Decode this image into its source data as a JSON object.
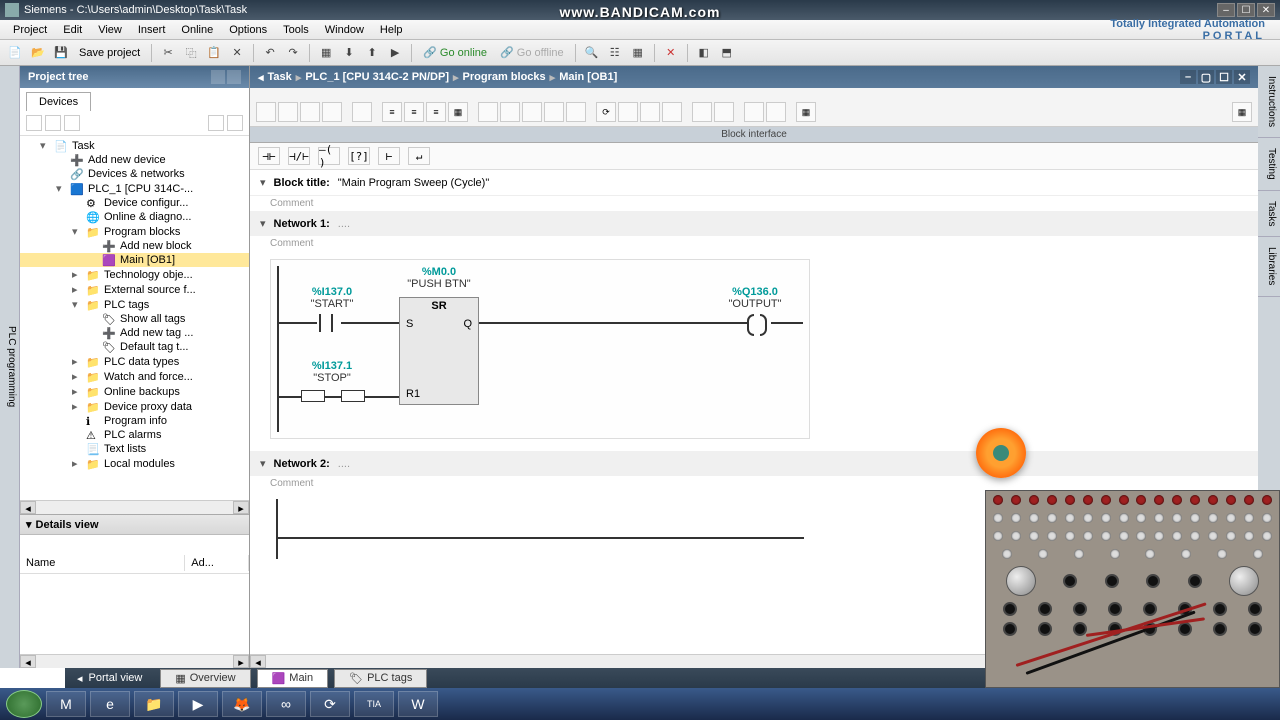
{
  "window": {
    "title": "Siemens  -  C:\\Users\\admin\\Desktop\\Task\\Task"
  },
  "watermark": "www.BANDICAM.com",
  "menus": [
    "Project",
    "Edit",
    "View",
    "Insert",
    "Online",
    "Options",
    "Tools",
    "Window",
    "Help"
  ],
  "brand": {
    "line1": "Totally Integrated Automation",
    "line2": "PORTAL"
  },
  "toolbar": {
    "save": "Save project",
    "go_online": "Go online",
    "go_offline": "Go offline"
  },
  "project_tree": {
    "title": "Project tree",
    "devices_tab": "Devices",
    "vtab_label": "PLC programming",
    "items": [
      {
        "ind": 1,
        "exp": "▾",
        "icon": "📄",
        "label": "Task"
      },
      {
        "ind": 2,
        "exp": "",
        "icon": "➕",
        "label": "Add new device"
      },
      {
        "ind": 2,
        "exp": "",
        "icon": "🔗",
        "label": "Devices & networks"
      },
      {
        "ind": 2,
        "exp": "▾",
        "icon": "🟦",
        "label": "PLC_1 [CPU 314C-..."
      },
      {
        "ind": 3,
        "exp": "",
        "icon": "⚙",
        "label": "Device configur..."
      },
      {
        "ind": 3,
        "exp": "",
        "icon": "🌐",
        "label": "Online & diagno..."
      },
      {
        "ind": 3,
        "exp": "▾",
        "icon": "📁",
        "label": "Program blocks"
      },
      {
        "ind": 4,
        "exp": "",
        "icon": "➕",
        "label": "Add new block"
      },
      {
        "ind": 4,
        "exp": "",
        "icon": "🟪",
        "label": "Main [OB1]",
        "selected": true
      },
      {
        "ind": 3,
        "exp": "▸",
        "icon": "📁",
        "label": "Technology obje..."
      },
      {
        "ind": 3,
        "exp": "▸",
        "icon": "📁",
        "label": "External source f..."
      },
      {
        "ind": 3,
        "exp": "▾",
        "icon": "📁",
        "label": "PLC tags"
      },
      {
        "ind": 4,
        "exp": "",
        "icon": "🏷",
        "label": "Show all tags"
      },
      {
        "ind": 4,
        "exp": "",
        "icon": "➕",
        "label": "Add new tag ..."
      },
      {
        "ind": 4,
        "exp": "",
        "icon": "🏷",
        "label": "Default tag t..."
      },
      {
        "ind": 3,
        "exp": "▸",
        "icon": "📁",
        "label": "PLC data types"
      },
      {
        "ind": 3,
        "exp": "▸",
        "icon": "📁",
        "label": "Watch and force..."
      },
      {
        "ind": 3,
        "exp": "▸",
        "icon": "📁",
        "label": "Online backups"
      },
      {
        "ind": 3,
        "exp": "▸",
        "icon": "📁",
        "label": "Device proxy data"
      },
      {
        "ind": 3,
        "exp": "",
        "icon": "ℹ",
        "label": "Program info"
      },
      {
        "ind": 3,
        "exp": "",
        "icon": "⚠",
        "label": "PLC alarms"
      },
      {
        "ind": 3,
        "exp": "",
        "icon": "📃",
        "label": "Text lists"
      },
      {
        "ind": 3,
        "exp": "▸",
        "icon": "📁",
        "label": "Local modules"
      }
    ]
  },
  "details": {
    "title": "Details view",
    "col_name": "Name",
    "col_add": "Ad..."
  },
  "breadcrumb": [
    "Task",
    "PLC_1 [CPU 314C-2 PN/DP]",
    "Program blocks",
    "Main [OB1]"
  ],
  "block_interface": "Block interface",
  "block_title_label": "Block title:",
  "block_title_value": "\"Main Program Sweep (Cycle)\"",
  "comment_label": "Comment",
  "network1": {
    "label": "Network 1:",
    "comment": "Comment"
  },
  "network2": {
    "label": "Network 2:",
    "comment": "Comment"
  },
  "ladder": {
    "start_addr": "%I137.0",
    "start_name": "\"START\"",
    "stop_addr": "%I137.1",
    "stop_name": "\"STOP\"",
    "sr_addr": "%M0.0",
    "sr_name": "\"PUSH BTN\"",
    "sr_type": "SR",
    "sr_s": "S",
    "sr_q": "Q",
    "sr_r": "R1",
    "out_addr": "%Q136.0",
    "out_name": "\"OUTPUT\""
  },
  "right_tabs": [
    "Instructions",
    "Testing",
    "Tasks",
    "Libraries"
  ],
  "bottom": {
    "portal": "Portal view",
    "overview": "Overview",
    "main": "Main",
    "plctags": "PLC tags"
  },
  "taskbar_items": [
    "M",
    "e",
    "📁",
    "▶",
    "🦊",
    "∞",
    "⟳",
    "TIA",
    "W"
  ]
}
